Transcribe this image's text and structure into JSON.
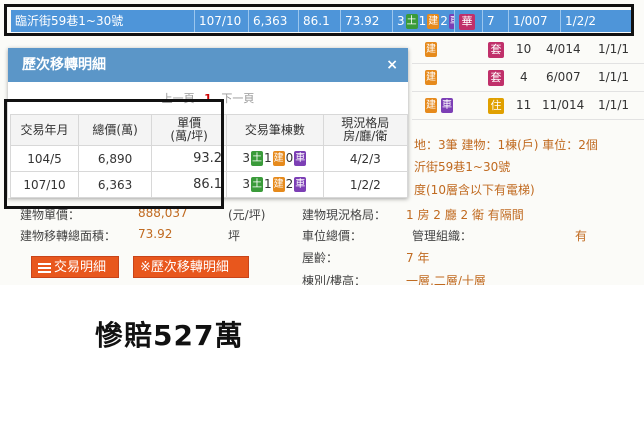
{
  "top_row": {
    "address": "臨沂街59巷1~30號",
    "date": "107/10",
    "total_price": "6,363",
    "unit_price": "86.1",
    "area": "73.92",
    "counts": [
      "3",
      "1",
      "2"
    ],
    "tags": [
      "土",
      "建",
      "車"
    ],
    "use_tag": "華",
    "floors": "7",
    "floor_info": "1/007",
    "layout": "1/2/2"
  },
  "bg_rows": [
    {
      "tags": [
        "建"
      ],
      "use": "套",
      "n": "10",
      "floor": "4/014",
      "layout": "1/1/1"
    },
    {
      "tags": [
        "建"
      ],
      "use": "套",
      "n": "4",
      "floor": "6/007",
      "layout": "1/1/1"
    },
    {
      "tags": [
        "建",
        "車"
      ],
      "use": "住",
      "n": "11",
      "floor": "11/014",
      "layout": "1/1/1"
    }
  ],
  "bg_detail": {
    "line1": "地：3筆 建物：1棟(戶) 車位：2個",
    "line2": "沂街59巷1~30號",
    "line3": "度(10層含以下有電梯)",
    "left_label_1": "建物單價：",
    "left_value_1": "888,037",
    "left_unit_1": "(元/坪)",
    "left_label_2": "建物移轉總面積：",
    "left_value_2": "73.92",
    "left_unit_2": "坪",
    "r_label_1": "建物現況格局：",
    "r_value_1": "1 房 2 廳 2 衛 有隔間",
    "r_label_2": "車位總價：",
    "r_label_2b": "管理組織：",
    "r_value_2b": "有",
    "r_label_3": "屋齡：",
    "r_value_3": "7 年",
    "r_label_4": "棟別/樓高：",
    "r_value_4": "一層,二層/十層"
  },
  "buttons": {
    "detail": "交易明細",
    "history": "※歷次移轉明細"
  },
  "popup": {
    "title": "歷次移轉明細",
    "close": "×",
    "pager": {
      "prev": "上一頁",
      "current": "1",
      "next": "下一頁"
    },
    "columns": [
      "交易年月",
      "總價(萬)",
      "單價\n(萬/坪)",
      "交易筆棟數",
      "現況格局\n房/廳/衛"
    ],
    "rows": [
      {
        "date": "104/5",
        "total": "6,890",
        "unit": "93.2",
        "counts": [
          "3",
          "1",
          "0"
        ],
        "layout": "4/2/3"
      },
      {
        "date": "107/10",
        "total": "6,363",
        "unit": "86.1",
        "counts": [
          "3",
          "1",
          "2"
        ],
        "layout": "1/2/2"
      }
    ],
    "tag_labels": [
      "土",
      "建",
      "車"
    ]
  },
  "caption": "慘賠527萬",
  "colors": {
    "land": "#3a9b3a",
    "building": "#e68a1c",
    "parking": "#7c3fb5",
    "header_blue": "#5b96c8",
    "button": "#e8571d"
  }
}
